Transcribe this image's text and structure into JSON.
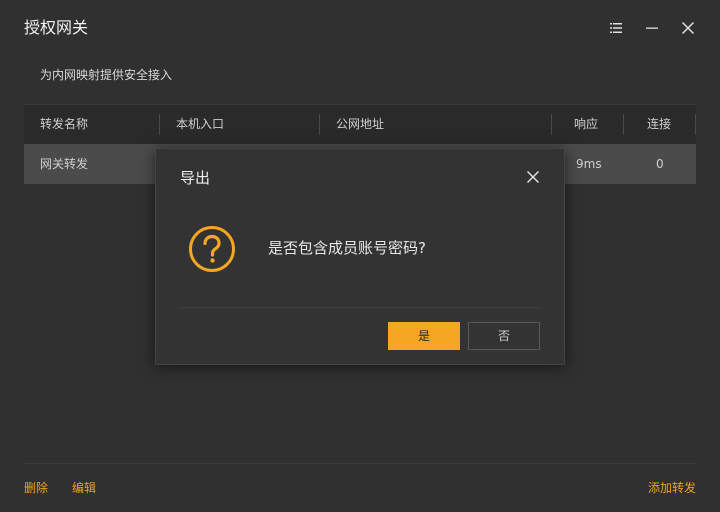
{
  "window": {
    "title": "授权网关",
    "subtitle": "为内网映射提供安全接入",
    "controls": [
      "menu-icon",
      "minimize-icon",
      "close-icon"
    ]
  },
  "table": {
    "headers": [
      "转发名称",
      "本机入口",
      "公网地址",
      "响应",
      "连接"
    ],
    "rows": [
      {
        "name": "网关转发",
        "local": "",
        "public": "",
        "response": "9ms",
        "connections": "0"
      }
    ]
  },
  "bottom": {
    "delete_label": "删除",
    "edit_label": "编辑",
    "add_label": "添加转发"
  },
  "dialog": {
    "title": "导出",
    "message": "是否包含成员账号密码?",
    "yes_label": "是",
    "no_label": "否",
    "icon": "question-icon"
  },
  "colors": {
    "accent": "#f5a623",
    "background": "#303030",
    "dialog_background": "#333333"
  }
}
